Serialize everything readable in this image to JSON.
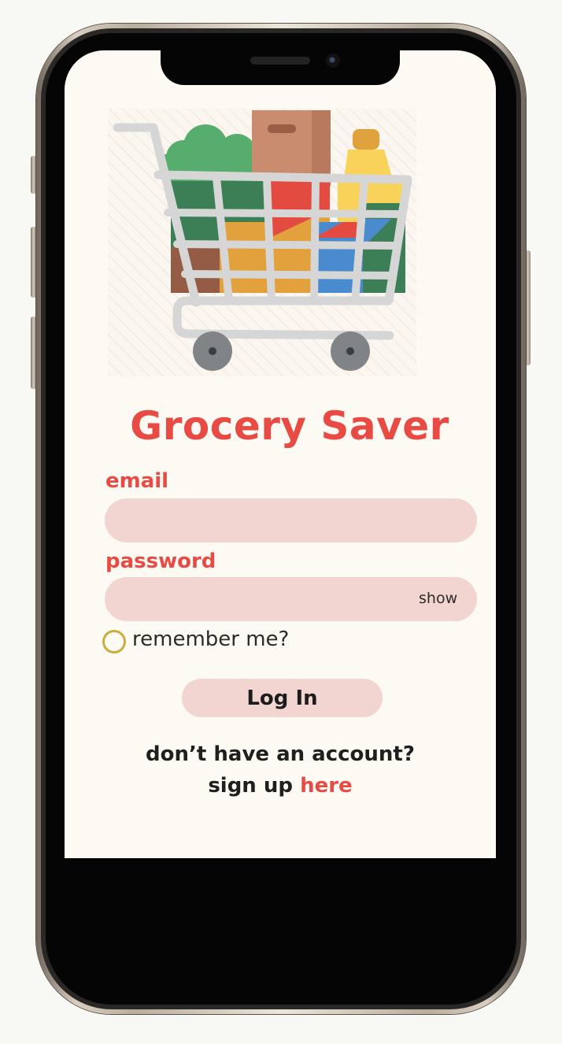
{
  "app": {
    "title": "Grocery Saver"
  },
  "illustration": {
    "icon": "shopping-cart-with-groceries"
  },
  "form": {
    "email_label": "email",
    "email_value": "",
    "email_placeholder": "",
    "password_label": "password",
    "password_value": "",
    "password_placeholder": "",
    "show_label": "show",
    "remember_label": "remember me?",
    "remember_checked": false,
    "login_label": "Log In"
  },
  "signup": {
    "prompt": "don’t have an account?",
    "prefix": "sign up",
    "link_label": "here"
  },
  "colors": {
    "accent": "#e84a44",
    "input_background": "#f2d5d1",
    "screen_background": "#fdf9f3",
    "radio_border": "#c9ae3e"
  }
}
